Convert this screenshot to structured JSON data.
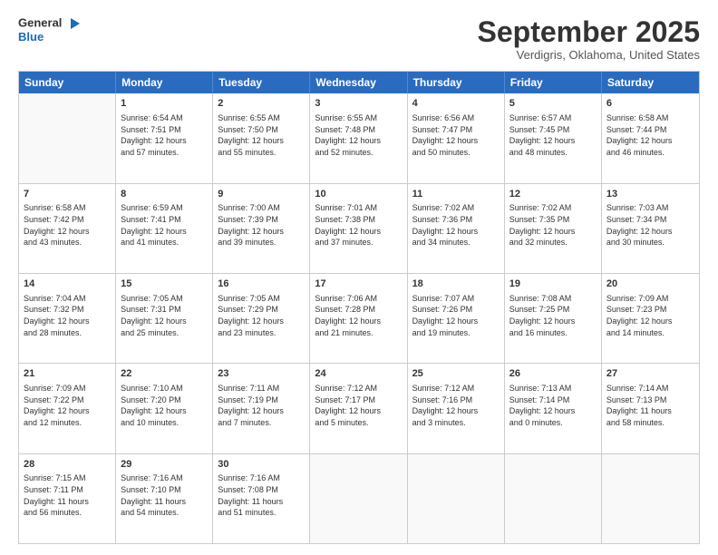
{
  "header": {
    "logo_line1": "General",
    "logo_line2": "Blue",
    "month": "September 2025",
    "location": "Verdigris, Oklahoma, United States"
  },
  "days_of_week": [
    "Sunday",
    "Monday",
    "Tuesday",
    "Wednesday",
    "Thursday",
    "Friday",
    "Saturday"
  ],
  "rows": [
    [
      {
        "day": "",
        "info": ""
      },
      {
        "day": "1",
        "info": "Sunrise: 6:54 AM\nSunset: 7:51 PM\nDaylight: 12 hours\nand 57 minutes."
      },
      {
        "day": "2",
        "info": "Sunrise: 6:55 AM\nSunset: 7:50 PM\nDaylight: 12 hours\nand 55 minutes."
      },
      {
        "day": "3",
        "info": "Sunrise: 6:55 AM\nSunset: 7:48 PM\nDaylight: 12 hours\nand 52 minutes."
      },
      {
        "day": "4",
        "info": "Sunrise: 6:56 AM\nSunset: 7:47 PM\nDaylight: 12 hours\nand 50 minutes."
      },
      {
        "day": "5",
        "info": "Sunrise: 6:57 AM\nSunset: 7:45 PM\nDaylight: 12 hours\nand 48 minutes."
      },
      {
        "day": "6",
        "info": "Sunrise: 6:58 AM\nSunset: 7:44 PM\nDaylight: 12 hours\nand 46 minutes."
      }
    ],
    [
      {
        "day": "7",
        "info": "Sunrise: 6:58 AM\nSunset: 7:42 PM\nDaylight: 12 hours\nand 43 minutes."
      },
      {
        "day": "8",
        "info": "Sunrise: 6:59 AM\nSunset: 7:41 PM\nDaylight: 12 hours\nand 41 minutes."
      },
      {
        "day": "9",
        "info": "Sunrise: 7:00 AM\nSunset: 7:39 PM\nDaylight: 12 hours\nand 39 minutes."
      },
      {
        "day": "10",
        "info": "Sunrise: 7:01 AM\nSunset: 7:38 PM\nDaylight: 12 hours\nand 37 minutes."
      },
      {
        "day": "11",
        "info": "Sunrise: 7:02 AM\nSunset: 7:36 PM\nDaylight: 12 hours\nand 34 minutes."
      },
      {
        "day": "12",
        "info": "Sunrise: 7:02 AM\nSunset: 7:35 PM\nDaylight: 12 hours\nand 32 minutes."
      },
      {
        "day": "13",
        "info": "Sunrise: 7:03 AM\nSunset: 7:34 PM\nDaylight: 12 hours\nand 30 minutes."
      }
    ],
    [
      {
        "day": "14",
        "info": "Sunrise: 7:04 AM\nSunset: 7:32 PM\nDaylight: 12 hours\nand 28 minutes."
      },
      {
        "day": "15",
        "info": "Sunrise: 7:05 AM\nSunset: 7:31 PM\nDaylight: 12 hours\nand 25 minutes."
      },
      {
        "day": "16",
        "info": "Sunrise: 7:05 AM\nSunset: 7:29 PM\nDaylight: 12 hours\nand 23 minutes."
      },
      {
        "day": "17",
        "info": "Sunrise: 7:06 AM\nSunset: 7:28 PM\nDaylight: 12 hours\nand 21 minutes."
      },
      {
        "day": "18",
        "info": "Sunrise: 7:07 AM\nSunset: 7:26 PM\nDaylight: 12 hours\nand 19 minutes."
      },
      {
        "day": "19",
        "info": "Sunrise: 7:08 AM\nSunset: 7:25 PM\nDaylight: 12 hours\nand 16 minutes."
      },
      {
        "day": "20",
        "info": "Sunrise: 7:09 AM\nSunset: 7:23 PM\nDaylight: 12 hours\nand 14 minutes."
      }
    ],
    [
      {
        "day": "21",
        "info": "Sunrise: 7:09 AM\nSunset: 7:22 PM\nDaylight: 12 hours\nand 12 minutes."
      },
      {
        "day": "22",
        "info": "Sunrise: 7:10 AM\nSunset: 7:20 PM\nDaylight: 12 hours\nand 10 minutes."
      },
      {
        "day": "23",
        "info": "Sunrise: 7:11 AM\nSunset: 7:19 PM\nDaylight: 12 hours\nand 7 minutes."
      },
      {
        "day": "24",
        "info": "Sunrise: 7:12 AM\nSunset: 7:17 PM\nDaylight: 12 hours\nand 5 minutes."
      },
      {
        "day": "25",
        "info": "Sunrise: 7:12 AM\nSunset: 7:16 PM\nDaylight: 12 hours\nand 3 minutes."
      },
      {
        "day": "26",
        "info": "Sunrise: 7:13 AM\nSunset: 7:14 PM\nDaylight: 12 hours\nand 0 minutes."
      },
      {
        "day": "27",
        "info": "Sunrise: 7:14 AM\nSunset: 7:13 PM\nDaylight: 11 hours\nand 58 minutes."
      }
    ],
    [
      {
        "day": "28",
        "info": "Sunrise: 7:15 AM\nSunset: 7:11 PM\nDaylight: 11 hours\nand 56 minutes."
      },
      {
        "day": "29",
        "info": "Sunrise: 7:16 AM\nSunset: 7:10 PM\nDaylight: 11 hours\nand 54 minutes."
      },
      {
        "day": "30",
        "info": "Sunrise: 7:16 AM\nSunset: 7:08 PM\nDaylight: 11 hours\nand 51 minutes."
      },
      {
        "day": "",
        "info": ""
      },
      {
        "day": "",
        "info": ""
      },
      {
        "day": "",
        "info": ""
      },
      {
        "day": "",
        "info": ""
      }
    ]
  ]
}
